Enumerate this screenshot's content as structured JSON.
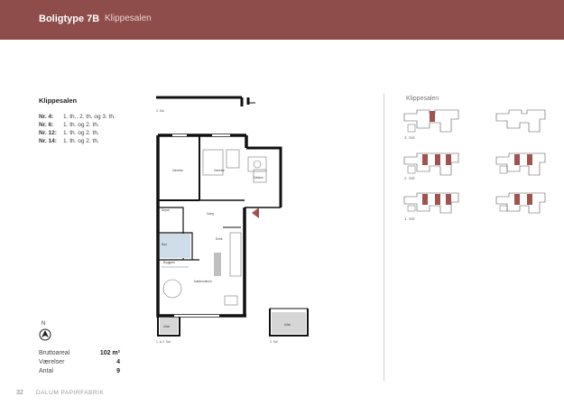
{
  "header": {
    "title": "Boligtype 7B",
    "separator": "-",
    "subtitle": "Klippesalen",
    "background": "#8e4c4a"
  },
  "info": {
    "title": "Klippesalen",
    "units": [
      {
        "nr": "Nr. 4:",
        "floors": "1. th., 2. th. og 3. th."
      },
      {
        "nr": "Nr. 6:",
        "floors": "1. th. og 2. th."
      },
      {
        "nr": "Nr. 12:",
        "floors": "1. th. og 2. th."
      },
      {
        "nr": "Nr. 14:",
        "floors": "1. th. og 2. th."
      }
    ]
  },
  "north": {
    "label": "N",
    "icon": "north-arrow-icon"
  },
  "stats": [
    {
      "label": "Bruttoareal",
      "value": "102 m²"
    },
    {
      "label": "Værelser",
      "value": "4"
    },
    {
      "label": "Antal",
      "value": "9"
    }
  ],
  "plan": {
    "rooms": [
      "Værelse",
      "Værelse",
      "Køkken",
      "Depot",
      "Gang",
      "Bad",
      "Entré",
      "Bryggers",
      "Køkken/alrum",
      "Altan",
      "Altan"
    ],
    "labels": [
      "2. Sal",
      "1. & 2. Sal",
      "2. Sal"
    ]
  },
  "site_plan": {
    "title": "Klippesalen",
    "floor_labels": [
      "3. Sal",
      "2. Sal",
      "1. Sal"
    ],
    "highlight_color": "#a0524e"
  },
  "footer": {
    "page": "32",
    "text": "DALUM PAPIRFABRIK"
  }
}
